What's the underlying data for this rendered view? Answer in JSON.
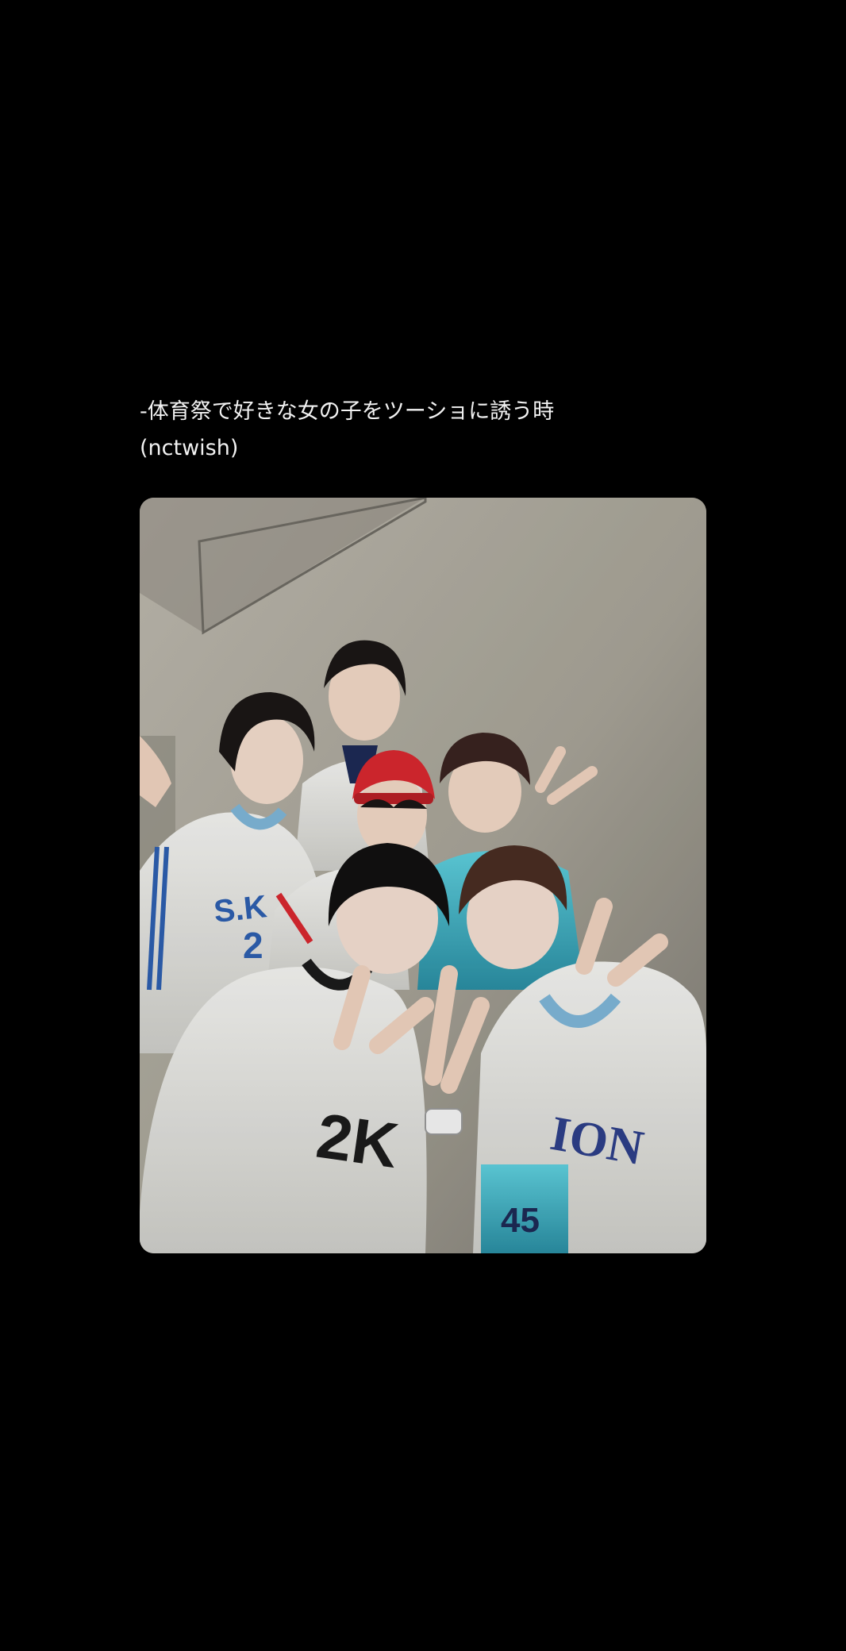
{
  "post": {
    "caption_line_1": "-体育祭で好きな女の子をツーショに誘う時",
    "caption_line_2": "(nctwish)"
  },
  "photo": {
    "jersey_text_left": "S.K",
    "jersey_number_left": "2",
    "jersey_text_center": "2K",
    "jersey_text_right": "ION",
    "jersey_number_bottom": "45",
    "colors": {
      "background": "#000000",
      "wall": "#a6a298",
      "jersey_white": "#e9e9e6",
      "jersey_blue": "#7fb6d8",
      "jersey_teal": "#3fb7c9",
      "cap_red": "#d8282f",
      "hair": "#1b1716"
    }
  }
}
